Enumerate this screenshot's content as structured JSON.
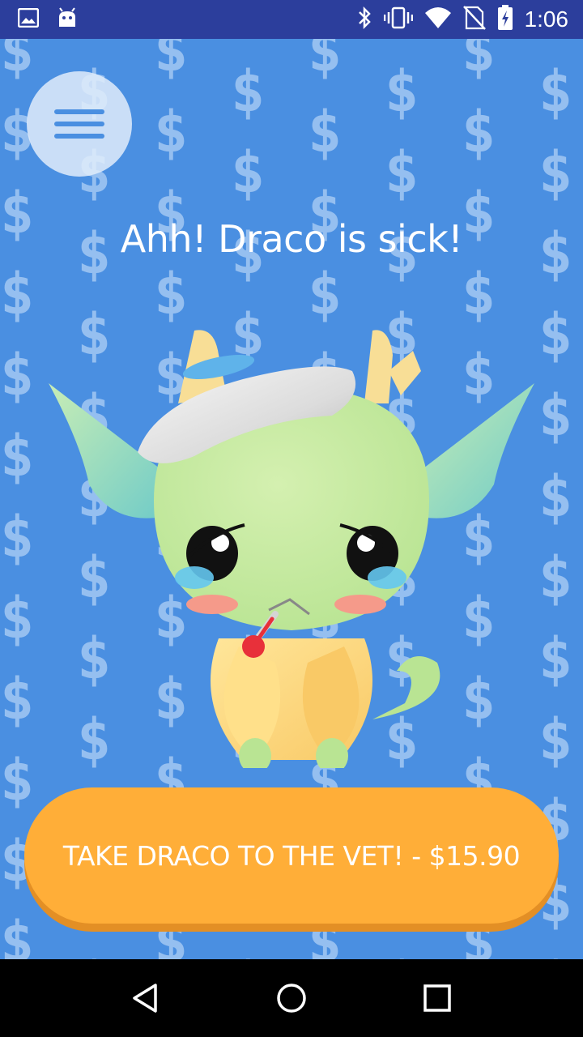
{
  "status_bar": {
    "time": "1:06",
    "left_icons": [
      "image-icon",
      "android-icon"
    ],
    "right_icons": [
      "bluetooth-icon",
      "vibrate-icon",
      "wifi-icon",
      "no-sim-icon",
      "battery-charging-icon"
    ]
  },
  "screen": {
    "headline": "Ahh! Draco is sick!",
    "vet_button_label": "TAKE DRACO TO THE VET! - $15.90",
    "background_symbol": "$"
  },
  "nav_bar": {
    "buttons": [
      "back-icon",
      "home-icon",
      "recents-icon"
    ]
  },
  "colors": {
    "background": "#4A8FE1",
    "status_bar": "#2C3E9C",
    "button": "#FFAE38",
    "button_shadow": "#E38F25",
    "dragon_body": "#C6EBA0"
  }
}
